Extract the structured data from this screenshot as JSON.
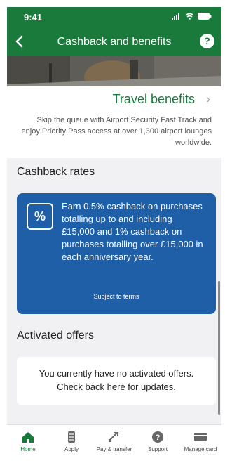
{
  "status": {
    "time": "9:41"
  },
  "header": {
    "title": "Cashback and benefits",
    "help_icon": "?"
  },
  "colors": {
    "brand_green": "#1a7a3c",
    "accent_blue": "#1f5fa8"
  },
  "travel": {
    "label": "Travel benefits",
    "chevron": "›",
    "description": "Skip the queue with Airport Security Fast Track and enjoy Priority Pass access at over 1,300 airport lounges worldwide."
  },
  "cashback": {
    "section_title": "Cashback rates",
    "icon_label": "%",
    "text": "Earn 0.5% cashback on purchases totalling up to and including £15,000 and 1% cashback on purchases totalling over £15,000 in each anniversary year.",
    "terms": "Subject to terms"
  },
  "offers": {
    "section_title": "Activated offers",
    "empty_text": "You currently have no activated offers. Check back here for updates."
  },
  "tabbar": {
    "items": [
      {
        "label": "Home",
        "icon": "home-icon"
      },
      {
        "label": "Apply",
        "icon": "documents-icon"
      },
      {
        "label": "Pay & transfer",
        "icon": "transfer-icon"
      },
      {
        "label": "Support",
        "icon": "help-icon"
      },
      {
        "label": "Manage card",
        "icon": "card-icon"
      }
    ]
  }
}
